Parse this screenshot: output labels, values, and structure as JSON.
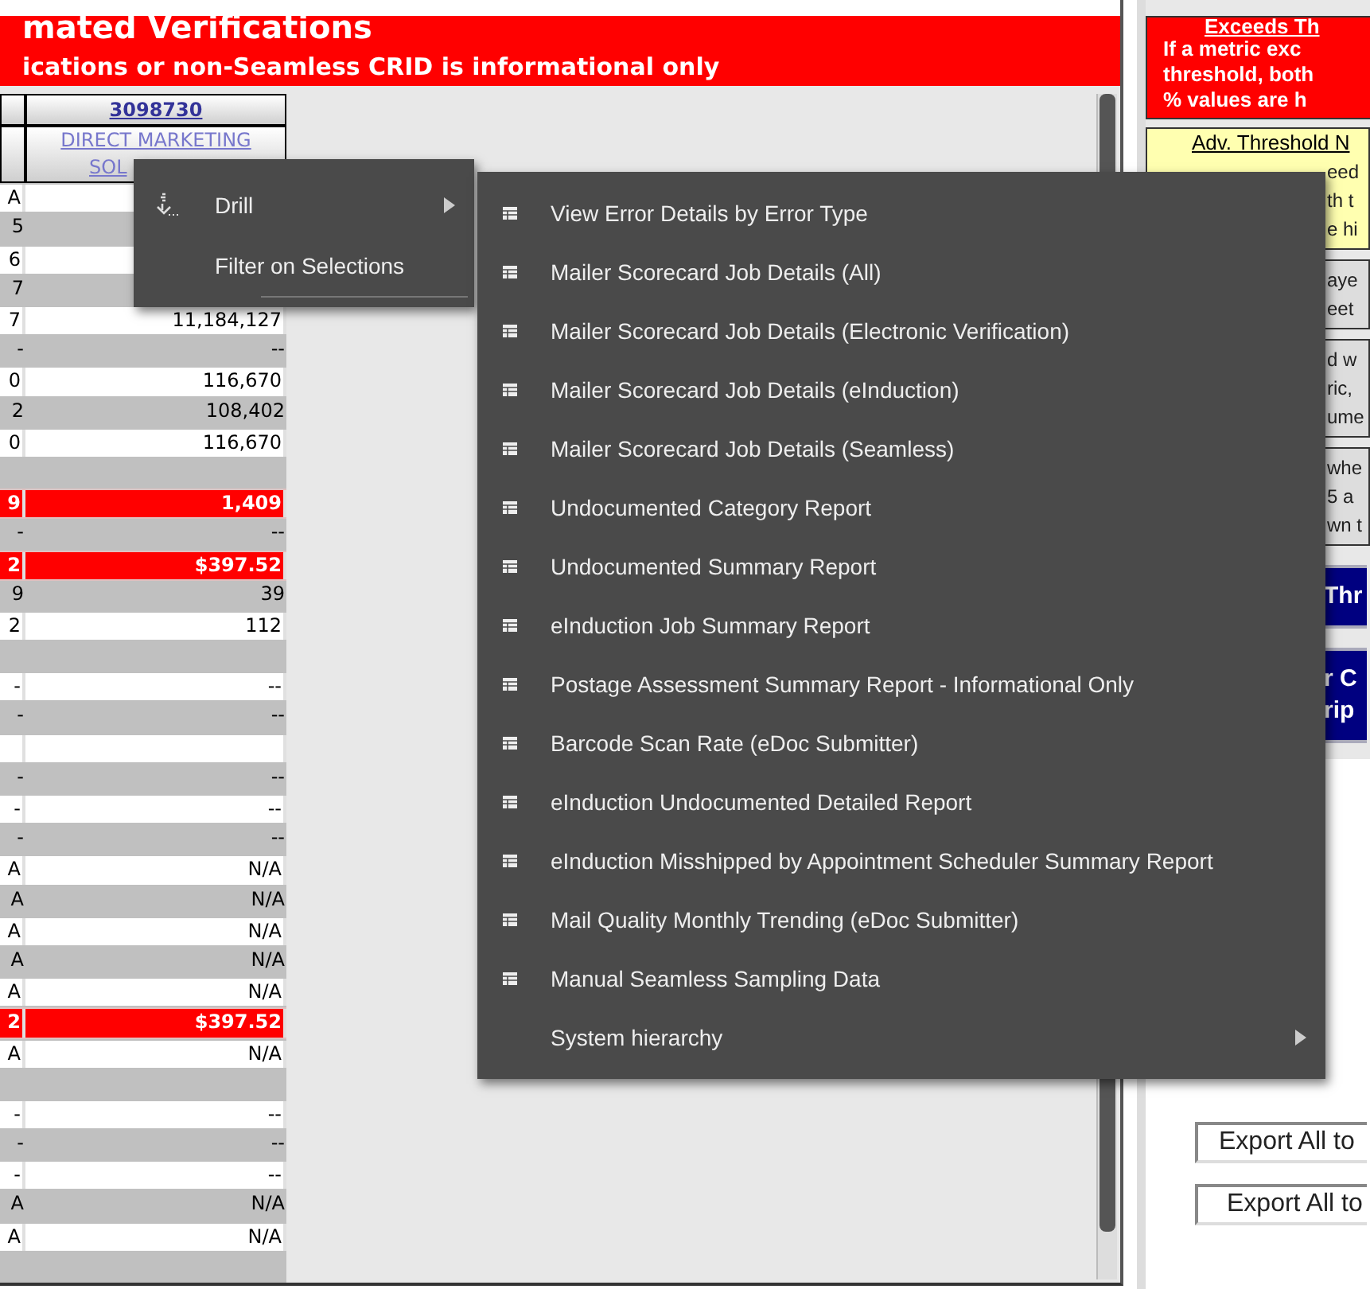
{
  "banner": {
    "title": "mated Verifications",
    "subtitle": "ications or non-Seamless CRID is informational only"
  },
  "table": {
    "header_id": "3098730",
    "header_name_lines": [
      "DIRECT MARKETING",
      "SOL"
    ],
    "rows": [
      {
        "column_1": "A",
        "highlighted": false
      },
      {
        "column_1": "5",
        "highlighted": false
      },
      {
        "column_1": "6",
        "highlighted": false
      },
      {
        "column_1": "7",
        "highlighted": false
      },
      {
        "column_1": "7",
        "column_2": "11,184,127",
        "highlighted": false
      },
      {
        "column_1": "-",
        "column_2": "--",
        "highlighted": false
      },
      {
        "column_1": "0",
        "column_2": "116,670",
        "highlighted": false
      },
      {
        "column_1": "2",
        "column_2": "108,402",
        "highlighted": false
      },
      {
        "column_1": "0",
        "column_2": "116,670",
        "highlighted": false
      },
      {
        "highlighted": false
      },
      {
        "column_1": "9",
        "column_2": "1,409",
        "highlighted": true
      },
      {
        "column_1": "-",
        "column_2": "--",
        "highlighted": false
      },
      {
        "column_1": "2",
        "column_2": "$397.52",
        "highlighted": true
      },
      {
        "column_1": "9",
        "column_2": "39",
        "highlighted": false
      },
      {
        "column_1": "2",
        "column_2": "112",
        "highlighted": false
      },
      {
        "highlighted": false
      },
      {
        "column_1": "-",
        "column_2": "--",
        "highlighted": false
      },
      {
        "column_1": "-",
        "column_2": "--",
        "highlighted": false
      },
      {
        "highlighted": false
      },
      {
        "column_1": "-",
        "column_2": "--",
        "highlighted": false
      },
      {
        "column_1": "-",
        "column_2": "--",
        "highlighted": false
      },
      {
        "column_1": "-",
        "column_2": "--",
        "highlighted": false
      },
      {
        "column_1": "A",
        "column_2": "N/A",
        "highlighted": false
      },
      {
        "column_1": "A",
        "column_2": "N/A",
        "highlighted": false
      },
      {
        "column_1": "A",
        "column_2": "N/A",
        "highlighted": false
      },
      {
        "column_1": "A",
        "column_2": "N/A",
        "highlighted": false
      },
      {
        "column_1": "A",
        "column_2": "N/A",
        "highlighted": false
      },
      {
        "column_1": "2",
        "column_2": "$397.52",
        "highlighted": true
      },
      {
        "column_1": "A",
        "column_2": "N/A",
        "highlighted": false
      },
      {
        "highlighted": false
      },
      {
        "column_1": "-",
        "column_2": "--",
        "highlighted": false
      },
      {
        "column_1": "-",
        "column_2": "--",
        "highlighted": false
      },
      {
        "column_1": "-",
        "column_2": "--",
        "highlighted": false
      },
      {
        "column_1": "A",
        "column_2": "N/A",
        "highlighted": false
      },
      {
        "column_1": "A",
        "column_2": "N/A",
        "highlighted": false
      },
      {
        "highlighted": false
      }
    ]
  },
  "legend": {
    "alert_box": {
      "heading": "Exceeds Th",
      "lines": [
        "If a metric exc",
        "threshold, both",
        "% values are h"
      ]
    },
    "advisory_box": {
      "heading": "Adv. Threshold N",
      "lines": [
        "eed",
        "th t",
        "e hi"
      ]
    },
    "note_boxes": [
      {
        "lines": [
          "aye",
          "eet"
        ]
      },
      {
        "lines": [
          "d w",
          "ric,",
          "ume"
        ]
      },
      {
        "lines": [
          "whe",
          "5 a",
          "wn t"
        ]
      }
    ],
    "nav_buttons": [
      {
        "lines": [
          "Thr"
        ]
      },
      {
        "lines": [
          "r C",
          "rip"
        ]
      }
    ],
    "export_buttons": [
      "Export All to",
      "Export All to"
    ]
  },
  "context_menu": {
    "items": [
      {
        "label": "Drill",
        "kind": "drill"
      },
      {
        "label": "Filter on Selections",
        "kind": "plain"
      }
    ]
  },
  "submenu": {
    "items": [
      {
        "label": "View Error Details by Error Type",
        "kind": "report"
      },
      {
        "label": "Mailer Scorecard Job Details (All)",
        "kind": "report"
      },
      {
        "label": "Mailer Scorecard Job Details (Electronic Verification)",
        "kind": "report"
      },
      {
        "label": "Mailer Scorecard Job Details (eInduction)",
        "kind": "report"
      },
      {
        "label": "Mailer Scorecard Job Details (Seamless)",
        "kind": "report"
      },
      {
        "label": "Undocumented Category Report",
        "kind": "report"
      },
      {
        "label": "Undocumented Summary Report",
        "kind": "report"
      },
      {
        "label": "eInduction Job Summary Report",
        "kind": "report"
      },
      {
        "label": "Postage Assessment Summary Report - Informational Only",
        "kind": "report"
      },
      {
        "label": "Barcode Scan Rate (eDoc Submitter)",
        "kind": "report"
      },
      {
        "label": "eInduction Undocumented Detailed Report",
        "kind": "report"
      },
      {
        "label": "eInduction Misshipped by Appointment Scheduler Summary Report",
        "kind": "report"
      },
      {
        "label": "Mail Quality Monthly Trending (eDoc Submitter)",
        "kind": "report"
      },
      {
        "label": "Manual Seamless Sampling Data",
        "kind": "report"
      },
      {
        "label": "System hierarchy",
        "kind": "submenu"
      }
    ]
  }
}
